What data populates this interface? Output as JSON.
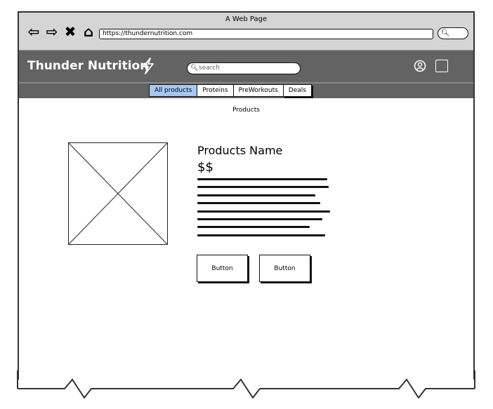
{
  "browser": {
    "page_title": "A Web Page",
    "url": "https://thundernutrition.com",
    "nav_icons": [
      "back-arrow-icon",
      "forward-arrow-icon",
      "close-x-icon",
      "home-icon"
    ],
    "search_icon": "search-icon"
  },
  "header": {
    "brand": "Thunder Nutrition",
    "brand_icon": "lightning-bolt-icon",
    "search_placeholder": "search",
    "user_icon": "user-circle-icon",
    "cart_icon": "cart-square-icon",
    "bg_color": "#636363"
  },
  "tabs": [
    {
      "label": "All products",
      "active": true
    },
    {
      "label": "Proteins",
      "active": false
    },
    {
      "label": "PreWorkouts",
      "active": false
    },
    {
      "label": "Deals",
      "active": false
    }
  ],
  "breadcrumb": "Products",
  "product": {
    "name": "Products Name",
    "price": "$$",
    "button1": "Button",
    "button2": "Button"
  },
  "colors": {
    "active_tab": "#a6c8f0"
  }
}
